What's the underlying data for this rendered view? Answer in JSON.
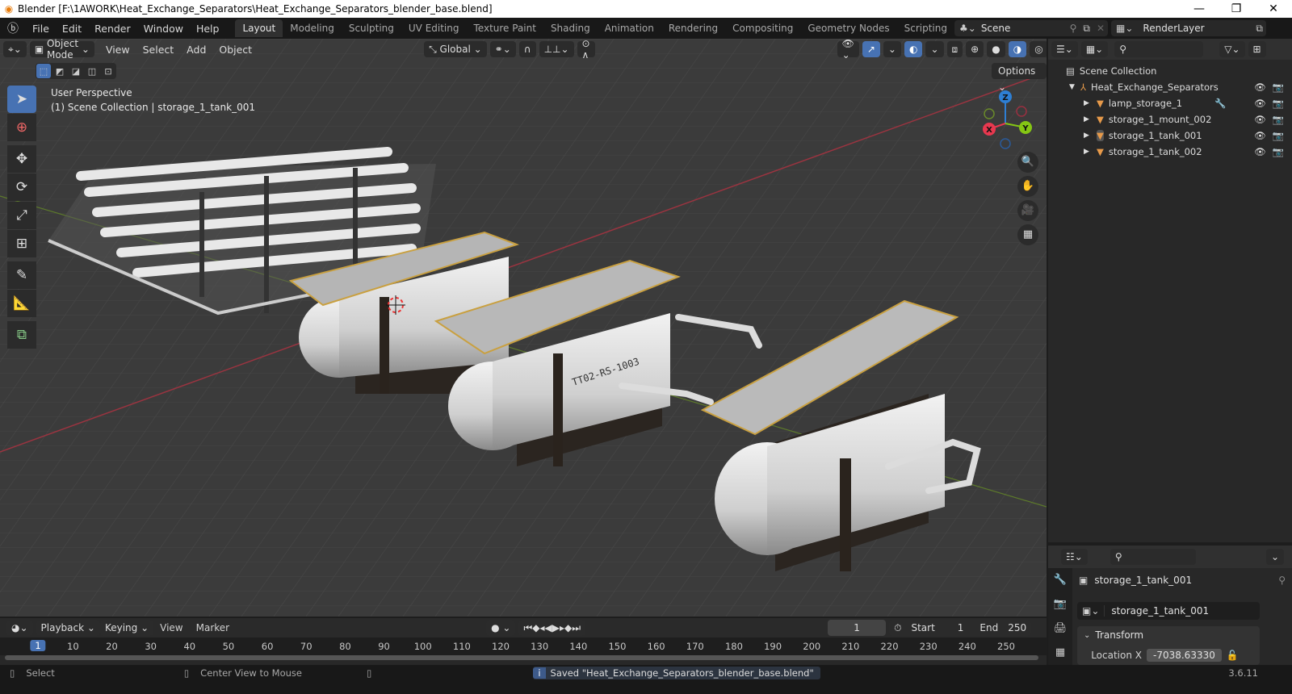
{
  "window": {
    "title": "Blender [F:\\1AWORK\\Heat_Exchange_Separators\\Heat_Exchange_Separators_blender_base.blend]",
    "controls": [
      "minimize",
      "restore",
      "close"
    ]
  },
  "topbar": {
    "menus": [
      "File",
      "Edit",
      "Render",
      "Window",
      "Help"
    ],
    "workspaces": [
      "Layout",
      "Modeling",
      "Sculpting",
      "UV Editing",
      "Texture Paint",
      "Shading",
      "Animation",
      "Rendering",
      "Compositing",
      "Geometry Nodes",
      "Scripting"
    ],
    "active_workspace": "Layout",
    "add_workspace": "+",
    "scene": "Scene",
    "view_layer": "RenderLayer"
  },
  "viewport": {
    "mode": "Object Mode",
    "menus": [
      "View",
      "Select",
      "Add",
      "Object"
    ],
    "orientation": "Global",
    "options_label": "Options",
    "view_name": "User Perspective",
    "collection_info": "(1) Scene Collection | storage_1_tank_001",
    "tank_label": "TT02-RS-1003",
    "gizmo_axes": {
      "x": "X",
      "y": "Y",
      "z": "Z"
    },
    "colors": {
      "x": "#e8384f",
      "y": "#85c614",
      "z": "#2e7fd4",
      "accent": "#4772b3"
    }
  },
  "outliner": {
    "root": "Scene Collection",
    "collection": "Heat_Exchange_Separators",
    "items": [
      {
        "name": "lamp_storage_1",
        "modifier": true
      },
      {
        "name": "storage_1_mount_002",
        "modifier": false
      },
      {
        "name": "storage_1_tank_001",
        "modifier": false,
        "active": true
      },
      {
        "name": "storage_1_tank_002",
        "modifier": false
      }
    ]
  },
  "properties": {
    "object_name": "storage_1_tank_001",
    "data_name": "storage_1_tank_001",
    "panel": "Transform",
    "location_x_label": "Location X",
    "location_x_value": "-7038.63330"
  },
  "timeline": {
    "menus": [
      "Playback",
      "Keying",
      "View",
      "Marker"
    ],
    "current_frame": "1",
    "start_label": "Start",
    "start": "1",
    "end_label": "End",
    "end": "250",
    "ticks": [
      "1",
      "10",
      "20",
      "30",
      "40",
      "50",
      "60",
      "70",
      "80",
      "90",
      "100",
      "110",
      "120",
      "130",
      "140",
      "150",
      "160",
      "170",
      "180",
      "190",
      "200",
      "210",
      "220",
      "230",
      "240",
      "250"
    ]
  },
  "statusbar": {
    "left_action": "Select",
    "middle_action": "Center View to Mouse",
    "message": "Saved \"Heat_Exchange_Separators_blender_base.blend\"",
    "version": "3.6.11"
  }
}
